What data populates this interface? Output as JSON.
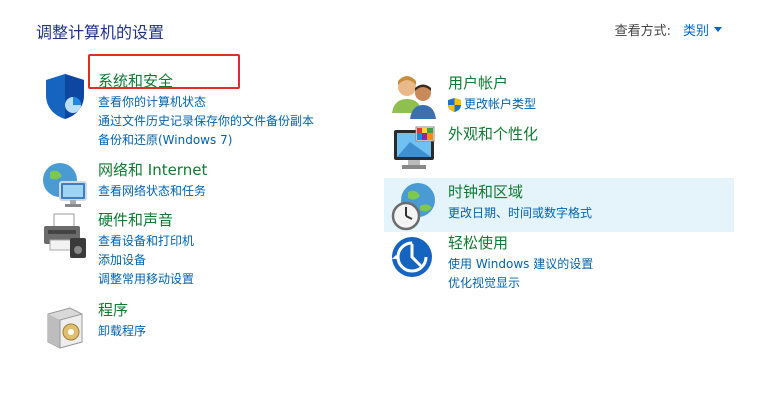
{
  "header": {
    "title": "调整计算机的设置",
    "view_by_label": "查看方式:",
    "view_by_value": "类别"
  },
  "left": [
    {
      "title": "系统和安全",
      "links": [
        "查看你的计算机状态",
        "通过文件历史记录保存你的文件备份副本",
        "备份和还原(Windows 7)"
      ]
    },
    {
      "title": "网络和 Internet",
      "links": [
        "查看网络状态和任务"
      ]
    },
    {
      "title": "硬件和声音",
      "links": [
        "查看设备和打印机",
        "添加设备",
        "调整常用移动设置"
      ]
    },
    {
      "title": "程序",
      "links": [
        "卸载程序"
      ]
    }
  ],
  "right": [
    {
      "title": "用户帐户",
      "links": [
        "更改帐户类型"
      ]
    },
    {
      "title": "外观和个性化",
      "links": []
    },
    {
      "title": "时钟和区域",
      "links": [
        "更改日期、时间或数字格式"
      ]
    },
    {
      "title": "轻松使用",
      "links": [
        "使用 Windows 建议的设置",
        "优化视觉显示"
      ]
    }
  ],
  "colors": {
    "accent": "#0063b1",
    "category": "#0f7a31",
    "highlight": "#e52a2a",
    "hover": "#e5f3fb"
  }
}
